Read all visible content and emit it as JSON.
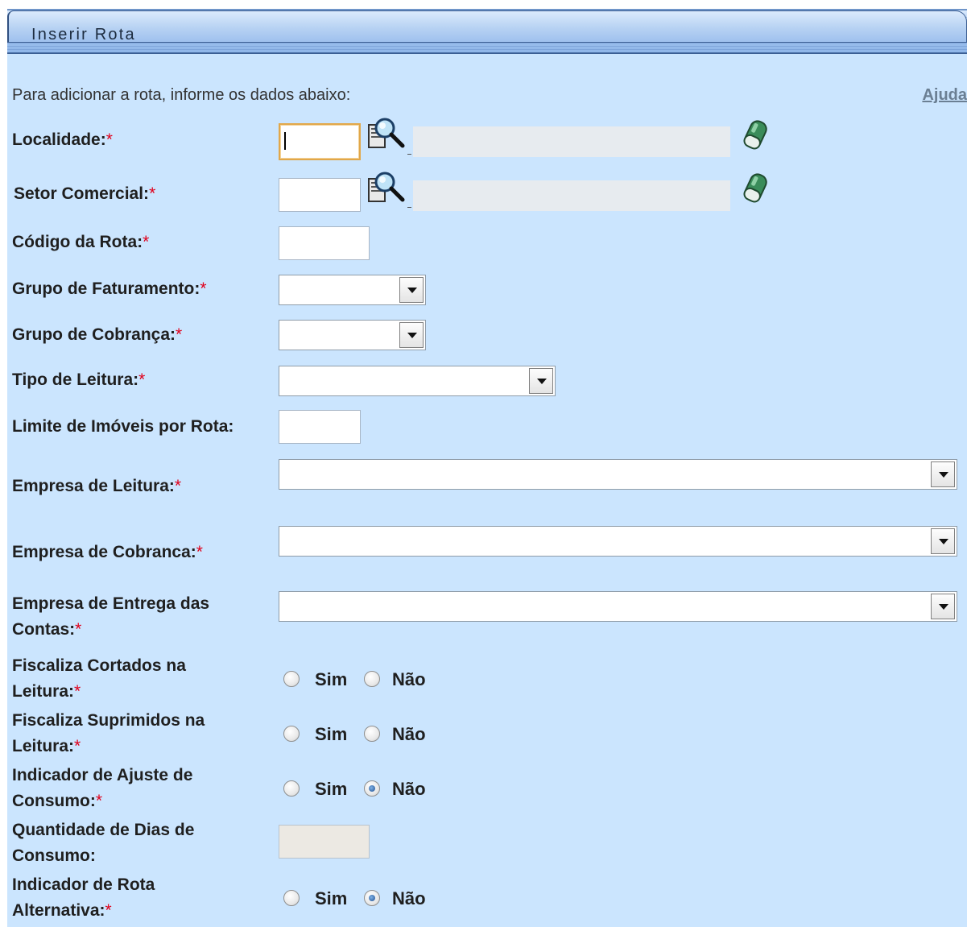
{
  "header": {
    "title": "Inserir Rota"
  },
  "intro": {
    "text": "Para adicionar a rota, informe os dados abaixo:",
    "help_link": "Ajuda"
  },
  "required_mark": "*",
  "fields": {
    "localidade": {
      "label": "Localidade:",
      "value": "",
      "description": ""
    },
    "setor_comercial": {
      "label": "Setor Comercial:",
      "value": "",
      "description": ""
    },
    "codigo_rota": {
      "label": "Código da Rota:",
      "value": ""
    },
    "grupo_faturamento": {
      "label": "Grupo de Faturamento:",
      "selected": ""
    },
    "grupo_cobranca": {
      "label": "Grupo de Cobrança:",
      "selected": ""
    },
    "tipo_leitura": {
      "label": "Tipo de Leitura:",
      "selected": ""
    },
    "limite_imoveis": {
      "label": "Limite de Imóveis por Rota:",
      "value": ""
    },
    "empresa_leitura": {
      "label": "Empresa de Leitura:",
      "selected": ""
    },
    "empresa_cobranca": {
      "label": "Empresa de Cobranca:",
      "selected": ""
    },
    "empresa_entrega": {
      "label_line1": "Empresa de Entrega das",
      "label_line2": "Contas:",
      "selected": ""
    },
    "fiscaliza_cortados": {
      "label_line1": "Fiscaliza Cortados na",
      "label_line2": "Leitura:",
      "selected": null
    },
    "fiscaliza_suprimidos": {
      "label_line1": "Fiscaliza Suprimidos na",
      "label_line2": "Leitura:",
      "selected": null
    },
    "ajuste_consumo": {
      "label_line1": "Indicador de Ajuste de",
      "label_line2": "Consumo:",
      "selected": "Não"
    },
    "dias_consumo": {
      "label_line1": "Quantidade de Dias de",
      "label_line2": "Consumo:",
      "value": ""
    },
    "rota_alternativa": {
      "label_line1": "Indicador de Rota",
      "label_line2": "Alternativa:",
      "selected": "Não"
    }
  },
  "radio_options": {
    "yes": "Sim",
    "no": "Não"
  },
  "colors": {
    "background": "#cbe5fe",
    "required": "#e0001b",
    "focus_border": "#e1a74a"
  }
}
